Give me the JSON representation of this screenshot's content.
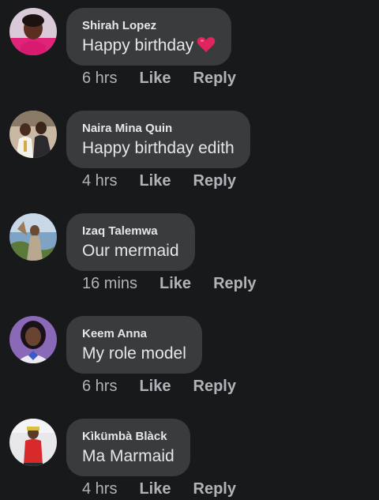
{
  "comments": [
    {
      "author": "Shirah Lopez",
      "text": "Happy birthday",
      "emoji": "red-heart",
      "time": "6 hrs",
      "like_label": "Like",
      "reply_label": "Reply"
    },
    {
      "author": "Naira Mina Quin",
      "text": "Happy birthday edith",
      "time": "4 hrs",
      "like_label": "Like",
      "reply_label": "Reply"
    },
    {
      "author": "Izaq Talemwa",
      "text": "Our mermaid",
      "time": "16 mins",
      "like_label": "Like",
      "reply_label": "Reply"
    },
    {
      "author": "Keem Anna",
      "text": "My role model",
      "time": "6 hrs",
      "like_label": "Like",
      "reply_label": "Reply"
    },
    {
      "author": "Kìkümbà Blàck",
      "text": "Ma Marmaid",
      "time": "4 hrs",
      "like_label": "Like",
      "reply_label": "Reply"
    }
  ],
  "colors": {
    "background": "#18191a",
    "bubble": "#3a3b3c",
    "primary_text": "#e4e6eb",
    "secondary_text": "#b0b3b8",
    "heart": "#e0245e"
  }
}
